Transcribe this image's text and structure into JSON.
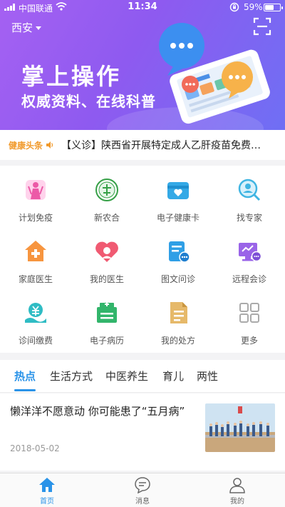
{
  "status_bar": {
    "carrier": "中国联通",
    "time": "11:34",
    "battery": "59%",
    "battery_level": 0.59
  },
  "header": {
    "city": "西安",
    "banner_title": "掌上操作",
    "banner_subtitle": "权威资料、在线科普"
  },
  "ticker": {
    "tag": "健康头条",
    "headline": "【义诊】陕西省开展特定成人乙肝疫苗免费接种"
  },
  "services": [
    {
      "label": "计划免疫",
      "icon": "vaccination-icon"
    },
    {
      "label": "新农合",
      "icon": "rural-insurance-icon"
    },
    {
      "label": "电子健康卡",
      "icon": "health-card-icon"
    },
    {
      "label": "找专家",
      "icon": "find-expert-icon"
    },
    {
      "label": "家庭医生",
      "icon": "family-doctor-icon"
    },
    {
      "label": "我的医生",
      "icon": "my-doctor-icon"
    },
    {
      "label": "图文问诊",
      "icon": "chat-consult-icon"
    },
    {
      "label": "远程会诊",
      "icon": "remote-consult-icon"
    },
    {
      "label": "诊间缴费",
      "icon": "payment-icon"
    },
    {
      "label": "电子病历",
      "icon": "medical-record-icon"
    },
    {
      "label": "我的处方",
      "icon": "prescription-icon"
    },
    {
      "label": "更多",
      "icon": "more-grid-icon"
    }
  ],
  "tabs": [
    {
      "label": "热点",
      "active": true
    },
    {
      "label": "生活方式",
      "active": false
    },
    {
      "label": "中医养生",
      "active": false
    },
    {
      "label": "育儿",
      "active": false
    },
    {
      "label": "两性",
      "active": false
    }
  ],
  "article": {
    "title": "懒洋洋不愿意动 你可能患了“五月病”",
    "date": "2018-05-02"
  },
  "bottom_nav": [
    {
      "label": "首页",
      "icon": "home-icon",
      "active": true
    },
    {
      "label": "消息",
      "icon": "message-icon",
      "active": false
    },
    {
      "label": "我的",
      "icon": "profile-icon",
      "active": false
    }
  ],
  "colors": {
    "accent": "#2a93e8",
    "banner_start": "#a561f2",
    "banner_end": "#6f6ff4",
    "ticker_tag": "#f19a2c"
  }
}
